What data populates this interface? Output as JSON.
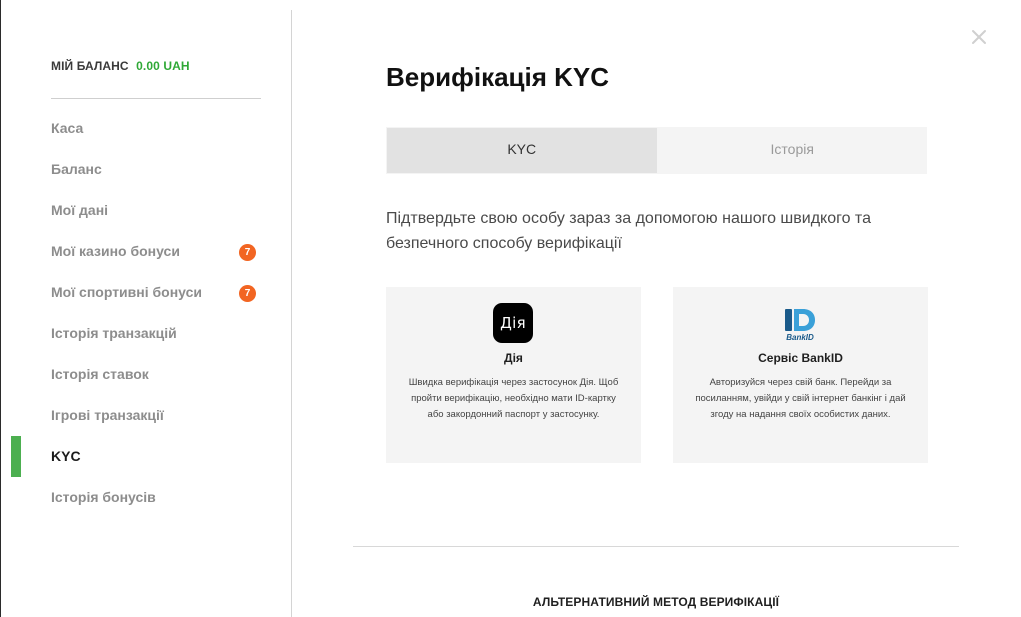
{
  "sidebar": {
    "balance_label": "МІЙ БАЛАНС",
    "balance_value": "0.00 UAH",
    "items": [
      {
        "label": "Каса"
      },
      {
        "label": "Баланс"
      },
      {
        "label": "Мої дані"
      },
      {
        "label": "Мої казино бонуси",
        "badge": "7"
      },
      {
        "label": "Мої спортивні бонуси",
        "badge": "7"
      },
      {
        "label": "Історія транзакцій"
      },
      {
        "label": "Історія ставок"
      },
      {
        "label": "Ігрові транзакції"
      },
      {
        "label": "KYC",
        "active": true
      },
      {
        "label": "Історія бонусів"
      }
    ]
  },
  "main": {
    "title": "Верифікація KYC",
    "tabs": [
      {
        "label": "KYC",
        "active": true
      },
      {
        "label": "Історія"
      }
    ],
    "intro": "Підтвердьте свою особу зараз за допомогою нашого швидкого та безпечного способу верифікації",
    "methods": [
      {
        "logo_text": "Дія",
        "icon": "diia-logo-icon",
        "title": "Дія",
        "description": "Швидка верифікація через застосунок Дія. Щоб пройти верифікацію, необхідно мати ID-картку або закордонний паспорт у застосунку."
      },
      {
        "logo_text": "BankID",
        "icon": "bankid-logo-icon",
        "title": "Сервіс BankID",
        "description": "Авторизуйся через свій банк. Перейди за посиланням, увійди у свій інтернет банкінг і дай згоду на надання своїх особистих даних."
      }
    ],
    "alternative_label": "АЛЬТЕРНАТИВНИЙ МЕТОД ВЕРИФІКАЦІЇ"
  },
  "colors": {
    "accent_green": "#4caf50",
    "balance_green": "#2fa836",
    "badge_orange": "#f26522",
    "bankid_blue": "#1a5a8a"
  },
  "icons": {
    "close": "close-icon"
  }
}
